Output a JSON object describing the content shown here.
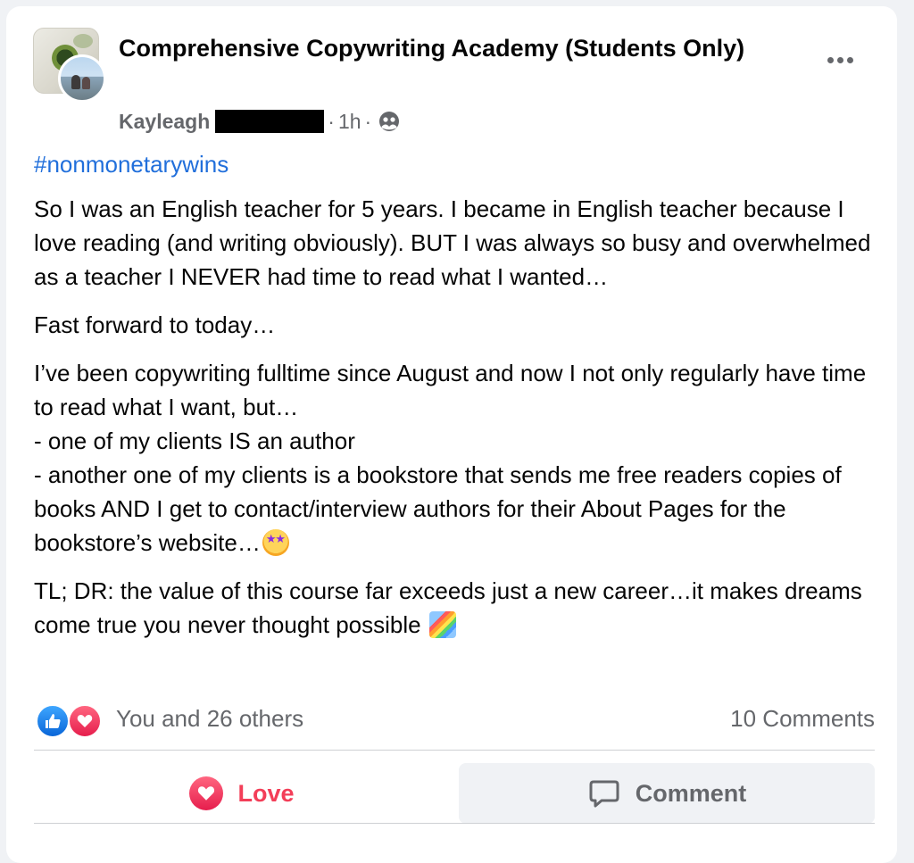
{
  "post": {
    "group_name": "Comprehensive Copywriting Academy (Students Only)",
    "author_name": "Kayleagh",
    "separator": "·",
    "time_ago": "1h",
    "privacy_icon": "group-members-icon",
    "more_icon": "more-options-icon",
    "hashtag": "#nonmonetarywins",
    "paragraphs": [
      "So I was an English teacher for 5 years. I became in English teacher because I love reading (and writing obviously). BUT I was always so busy and overwhelmed as a teacher I NEVER had time to read what I wanted…",
      "Fast forward to today…",
      "I’ve been copywriting fulltime since August and now I not only regularly have time to read what I want, but…",
      "- one of my clients IS an author",
      "- another one of my clients is a bookstore that sends me free readers copies of books AND I get to contact/interview authors for their About Pages for the bookstore’s website…",
      "TL; DR: the value of this course far exceeds just a new career…it makes dreams come true you never thought possible"
    ]
  },
  "reactions": {
    "icons": [
      "like-icon",
      "love-icon"
    ],
    "summary": "You and 26 others",
    "comments_count": "10 Comments"
  },
  "actions": {
    "love_label": "Love",
    "comment_label": "Comment"
  },
  "colors": {
    "link": "#216fdb",
    "love": "#f33e58",
    "secondary_text": "#65676b",
    "like_blue": "#0a66d8"
  }
}
